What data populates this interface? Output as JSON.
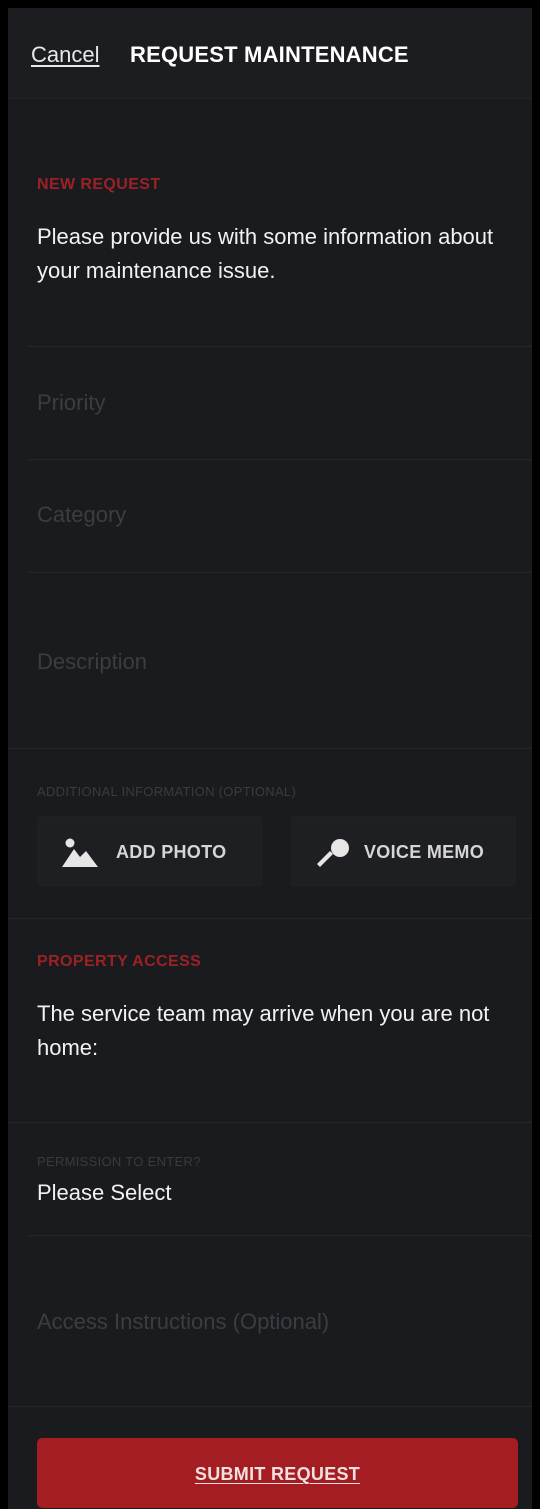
{
  "header": {
    "cancel_label": "Cancel",
    "title": "REQUEST MAINTENANCE"
  },
  "new_request": {
    "section_label": "NEW REQUEST",
    "intro": "Please provide us with some information about your maintenance issue."
  },
  "fields": {
    "priority_placeholder": "Priority",
    "category_placeholder": "Category",
    "description_placeholder": "Description"
  },
  "additional": {
    "label": "ADDITIONAL INFORMATION (OPTIONAL)",
    "add_photo_label": "ADD PHOTO",
    "add_photo_icon": "image-icon",
    "voice_memo_label": "VOICE MEMO",
    "voice_memo_icon": "microphone-icon"
  },
  "property_access": {
    "section_label": "PROPERTY ACCESS",
    "intro": "The service team may arrive when you are not home:",
    "permission_label": "PERMISSION TO ENTER?",
    "permission_value": "Please Select",
    "access_instructions_placeholder": "Access Instructions (Optional)"
  },
  "submit": {
    "label": "SUBMIT REQUEST"
  },
  "colors": {
    "accent": "#a41d22",
    "section_label": "#9c2125",
    "background": "#1a1b1e"
  }
}
